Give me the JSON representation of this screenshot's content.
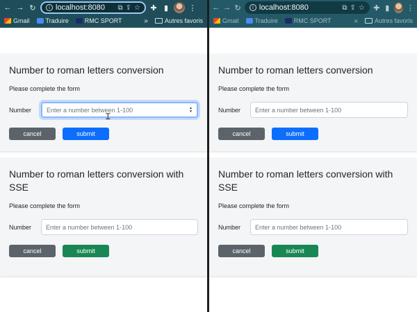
{
  "browser_left": {
    "address": "localhost:8080",
    "bookmarks": [
      "Gmail",
      "Traduire",
      "RMC SPORT"
    ],
    "bookmarks_more": "»",
    "bookmarks_folder": "Autres favoris"
  },
  "browser_right": {
    "address": "localhost:8080",
    "bookmarks": [
      "Gmail",
      "Traduire",
      "RMC SPORT"
    ],
    "bookmarks_more": "»",
    "bookmarks_folder": "Autres favoris"
  },
  "cards": [
    {
      "title": "Number to roman letters conversion",
      "subtitle": "Please complete the form",
      "field_label": "Number",
      "placeholder": "Enter a number between 1-100",
      "cancel": "cancel",
      "submit": "submit",
      "submit_color": "#0d6efd"
    },
    {
      "title": "Number to roman letters conversion with SSE",
      "subtitle": "Please complete the form",
      "field_label": "Number",
      "placeholder": "Enter a number between 1-100",
      "cancel": "cancel",
      "submit": "submit",
      "submit_color": "#198754"
    }
  ]
}
